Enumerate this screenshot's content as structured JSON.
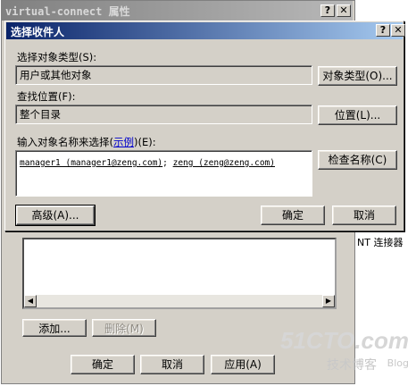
{
  "bg_window": {
    "title": "virtual-connect 属性",
    "right_text": "NT 连接器",
    "buttons": {
      "add": "添加...",
      "remove": "删除(M)",
      "ok": "确定",
      "cancel": "取消",
      "apply": "应用(A)"
    }
  },
  "dialog": {
    "title": "选择收件人",
    "help_btn": "?",
    "close_btn": "✕",
    "object_type_label": "选择对象类型(S):",
    "object_type_value": "用户或其他对象",
    "object_type_button": "对象类型(O)...",
    "location_label": "查找位置(F):",
    "location_value": "整个目录",
    "location_button": "位置(L)...",
    "names_label_prefix": "输入对象名称来选择",
    "names_label_link": "示例",
    "names_label_suffix": "(E):",
    "names_entry_1": "manager1 (manager1@zeng.com)",
    "names_sep": "; ",
    "names_entry_2": "zeng (zeng@zeng.com)",
    "check_names_button": "检查名称(C)",
    "advanced_button": "高级(A)...",
    "ok_button": "确定",
    "cancel_button": "取消"
  },
  "watermark": {
    "logo": "51CTO.com",
    "sub1": "技术博客",
    "sub2": "Blog"
  },
  "colors": {
    "titlebar_active": "#0a246a",
    "titlebar_inactive": "#808080",
    "face": "#d4d0c8"
  }
}
